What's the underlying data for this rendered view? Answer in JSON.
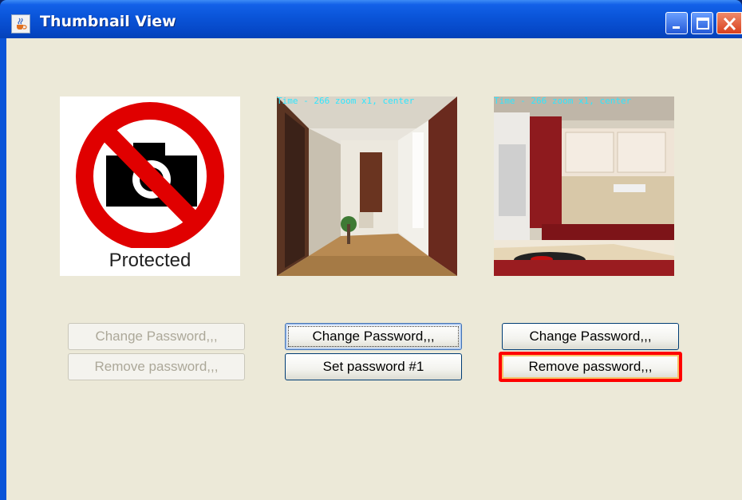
{
  "window": {
    "title": "Thumbnail View",
    "icon": "java-cup-icon",
    "controls": [
      "minimize-icon",
      "maximize-icon",
      "close-icon"
    ]
  },
  "thumbnails": [
    {
      "image": "no-camera-icon",
      "caption": "Protected",
      "overlay": "",
      "buttons": [
        {
          "label": "Change Password,,,",
          "state": "disabled"
        },
        {
          "label": "Remove password,,,",
          "state": "disabled"
        }
      ]
    },
    {
      "image": "hallway-photo",
      "caption": "",
      "overlay": "Time - 266 zoom x1, center",
      "buttons": [
        {
          "label": "Change Password,,,",
          "state": "focused"
        },
        {
          "label": "Set password #1",
          "state": "enabled"
        }
      ]
    },
    {
      "image": "kitchen-photo",
      "caption": "",
      "overlay": "Time - 266 zoom x1, center",
      "buttons": [
        {
          "label": "Change Password,,,",
          "state": "enabled"
        },
        {
          "label": "Remove password,,,",
          "state": "highlighted"
        }
      ]
    }
  ],
  "colors": {
    "titlebar": "#0a54d8",
    "client_bg": "#ece9d8",
    "highlight": "#ff0000",
    "overlay_text": "#2fe6ff"
  }
}
